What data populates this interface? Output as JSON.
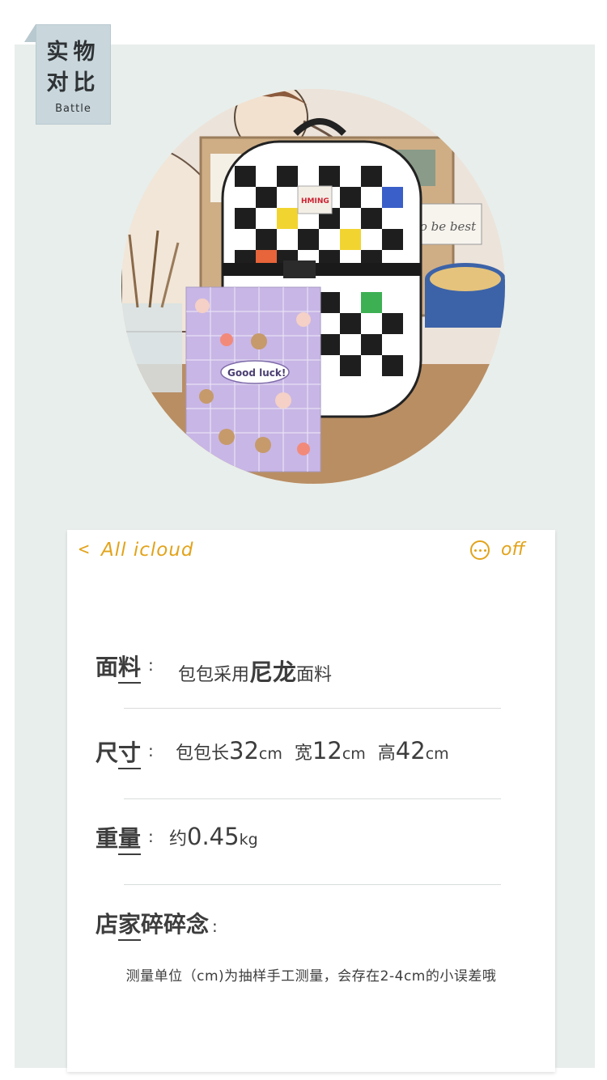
{
  "tag": {
    "line1": "实物",
    "line2": "对比",
    "sub": "Battle"
  },
  "nav": {
    "back": "<",
    "title": "All icloud",
    "off": "off"
  },
  "specs": [
    {
      "label_a": "面",
      "label_b": "料",
      "colon": ":",
      "text1": "包包采用",
      "bold": "尼龙",
      "text2": "面料"
    },
    {
      "label_a": "尺",
      "label_b": "寸",
      "colon": ":",
      "p1": "包包长",
      "v1": "32",
      "u1": "cm",
      "p2": "宽",
      "v2": "12",
      "u2": "cm",
      "p3": "高",
      "v3": "42",
      "u3": "cm"
    },
    {
      "label_a": "重",
      "label_b": "量",
      "colon": ":",
      "p1": "约",
      "v1": "0.45",
      "u1": "kg"
    },
    {
      "label_a": "店",
      "label_b": "家",
      "label_c": "碎碎念",
      "colon": ":"
    }
  ],
  "note": "测量单位（cm)为抽样手工测量，会存在2-4cm的小误差哦",
  "colors": {
    "accent": "#e2a31b",
    "panel": "#e8eeeb",
    "tag": "#c9d7dc"
  },
  "photo": {
    "notebook_text": "Good luck!",
    "bag_label": "HMING",
    "board_text": "To be best"
  }
}
